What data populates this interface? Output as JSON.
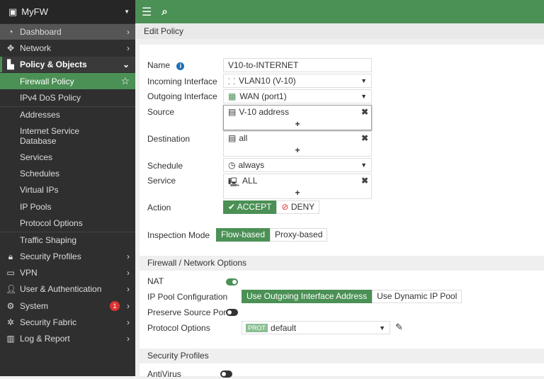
{
  "app": {
    "device_name": "MyFW"
  },
  "sidebar": {
    "items": [
      {
        "label": "Dashboard",
        "icon": "dashboard-icon"
      },
      {
        "label": "Network",
        "icon": "network-icon"
      },
      {
        "label": "Policy & Objects",
        "icon": "policy-icon"
      },
      {
        "label": "Firewall Policy"
      },
      {
        "label": "IPv4 DoS Policy"
      },
      {
        "label": "Addresses"
      },
      {
        "label": "Internet Service Database"
      },
      {
        "label": "Services"
      },
      {
        "label": "Schedules"
      },
      {
        "label": "Virtual IPs"
      },
      {
        "label": "IP Pools"
      },
      {
        "label": "Protocol Options"
      },
      {
        "label": "Traffic Shaping"
      },
      {
        "label": "Security Profiles",
        "icon": "lock-icon"
      },
      {
        "label": "VPN",
        "icon": "laptop-icon"
      },
      {
        "label": "User & Authentication",
        "icon": "user-icon"
      },
      {
        "label": "System",
        "icon": "gear-icon",
        "badge": "1"
      },
      {
        "label": "Security Fabric",
        "icon": "fabric-icon"
      },
      {
        "label": "Log & Report",
        "icon": "chart-icon"
      }
    ]
  },
  "page": {
    "title": "Edit Policy"
  },
  "form": {
    "name_label": "Name",
    "name_value": "V10-to-INTERNET",
    "incoming_label": "Incoming Interface",
    "incoming_value": "VLAN10 (V-10)",
    "outgoing_label": "Outgoing Interface",
    "outgoing_value": "WAN (port1)",
    "source_label": "Source",
    "source_value": "V-10 address",
    "destination_label": "Destination",
    "destination_value": "all",
    "schedule_label": "Schedule",
    "schedule_value": "always",
    "service_label": "Service",
    "service_value": "ALL",
    "action_label": "Action",
    "accept": "ACCEPT",
    "deny": "DENY",
    "inspection_label": "Inspection Mode",
    "flow": "Flow-based",
    "proxy": "Proxy-based",
    "plus": "+"
  },
  "fw_options": {
    "title": "Firewall / Network Options",
    "nat_label": "NAT",
    "nat_on": true,
    "ippool_label": "IP Pool Configuration",
    "ippool_opt1": "Use Outgoing Interface Address",
    "ippool_opt2": "Use Dynamic IP Pool",
    "preserve_label": "Preserve Source Port",
    "preserve_on": false,
    "proto_label": "Protocol Options",
    "proto_badge": "PROT",
    "proto_value": "default"
  },
  "security_profiles": {
    "title": "Security Profiles",
    "antivirus_label": "AntiVirus",
    "antivirus_on": false
  },
  "colors": {
    "accent": "#4b9055",
    "sidebar": "#2f2f2f"
  }
}
